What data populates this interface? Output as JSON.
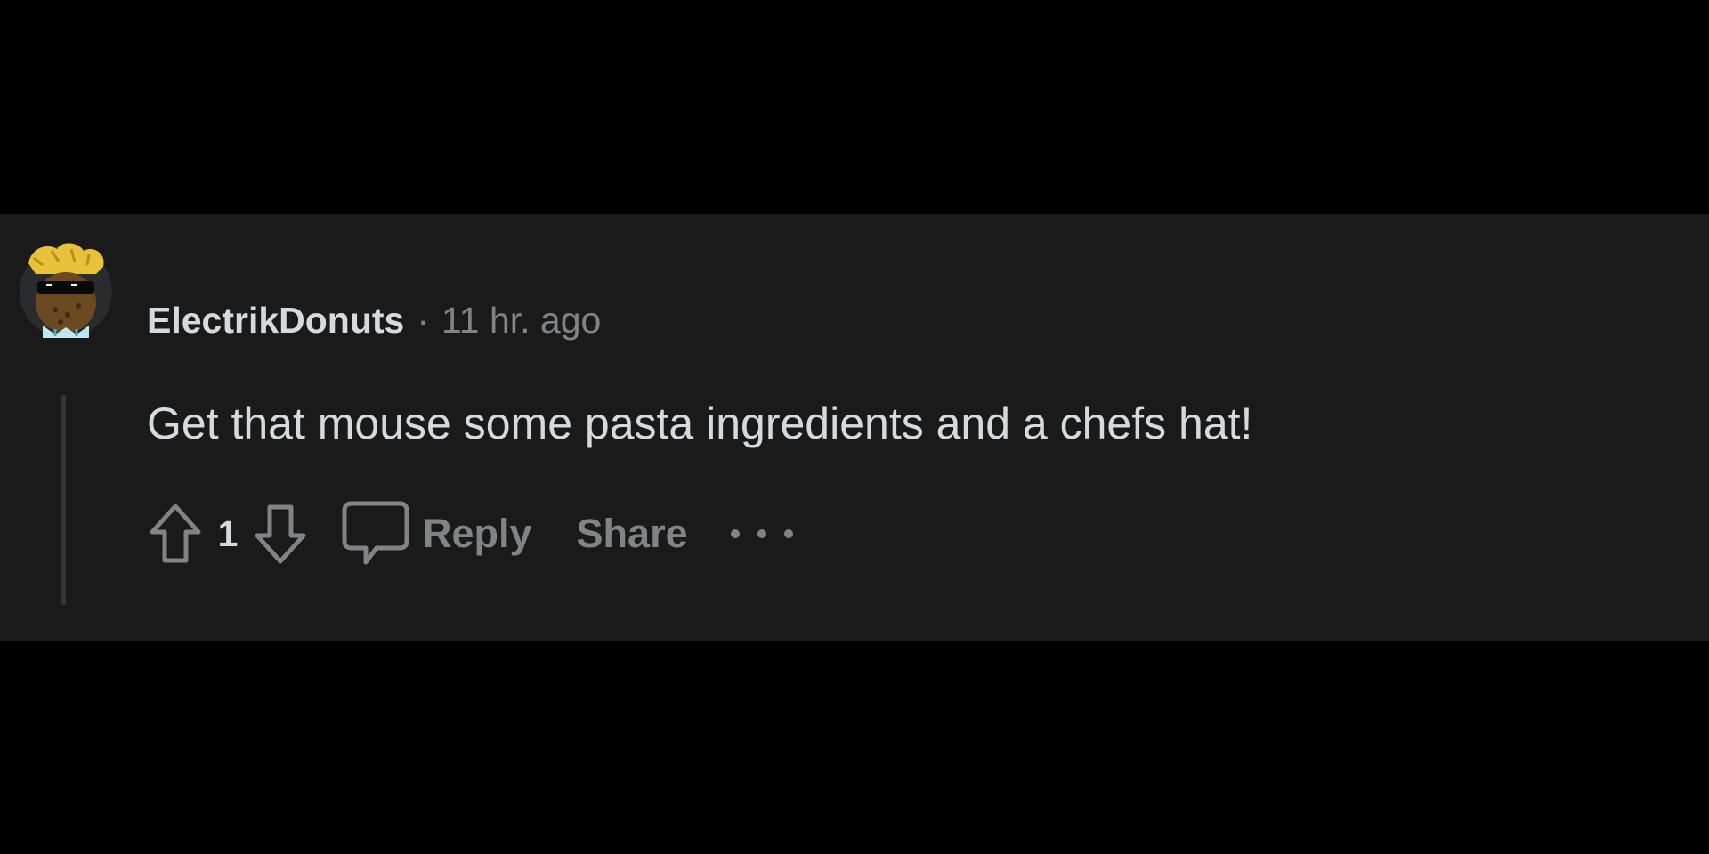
{
  "comment": {
    "username": "ElectrikDonuts",
    "separator": "·",
    "timestamp": "11 hr. ago",
    "body": "Get that mouse some pasta ingredients and a chefs hat!",
    "avatar_icon": "snoo-avatar-sunglasses",
    "actions": {
      "upvote_icon": "arrow-up-icon",
      "vote_count": "1",
      "downvote_icon": "arrow-down-icon",
      "comment_icon": "speech-bubble-icon",
      "reply_label": "Reply",
      "share_label": "Share",
      "more_icon": "ellipsis-icon"
    }
  },
  "colors": {
    "page_background": "#000000",
    "card_background": "#1a1a1b",
    "primary_text": "#d7dadc",
    "secondary_text": "#818384",
    "thread_line": "#343536"
  }
}
